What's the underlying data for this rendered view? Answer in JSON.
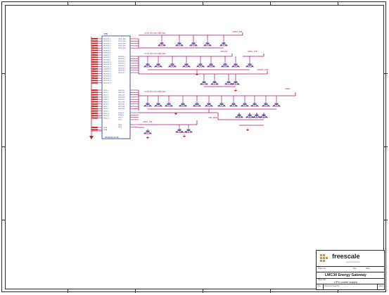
{
  "title_block": {
    "company": "freescale",
    "company_tagline": "semiconductor",
    "project": "LMC30 Energy Gateway",
    "sheet_title": "CPU power supply",
    "drawn_label": "Drawn by:",
    "page_label": "Page title:",
    "size_label": "Size",
    "doc_label": "Document Number",
    "rev_label": "Rev",
    "sheet_label": "Sheet",
    "date_label": "Date:",
    "drawn_value": "",
    "rev_value": ""
  },
  "ic": {
    "ref": "U5B",
    "part": "MCIMX28LCVL2B",
    "left_pins": [
      "VDDIO33_0",
      "VDDIO33_1",
      "VDDIO33_2",
      "VDDIO33_3",
      "VDDIO33_4",
      "VDDIO33_5",
      "VDDIO33_6",
      "VDDIO33_7",
      "VDDIO33_8",
      "VDDIO33_9",
      "VDDIO33_10",
      "VDDIO33_11",
      "VDDIO33_12",
      "VDDIO33_13",
      "VDDIO33_14",
      "VDDIO33_15",
      "VDDIO33_16",
      "VDDIO33_17",
      "VDDIO33_18",
      "VDDIO33_19"
    ],
    "left_pins_b": [
      "VDDD_0",
      "VDDD_1",
      "VDDD_2",
      "VDDD_3",
      "VDDD_4",
      "VDDD_5",
      "VDDD_6",
      "VDDD_7",
      "VDDD_8",
      "VDDD_9",
      "VDDD_10",
      "VDDD_11",
      "VDDD_12"
    ],
    "left_pins_c": [
      "VDDA",
      "VSSA"
    ],
    "right_pins": [
      "VDDIO_EMI",
      "VDDIO_EMI",
      "VDDIO_EMI",
      "VDDIO_EMI",
      "VDDIO_EMI"
    ],
    "right_pins_b": [
      "VDDIO18_0",
      "VDDIO18_1",
      "VDDIO18_2",
      "VDDIO18_3",
      "VDDIO18_4",
      "VDDIO18_5",
      "VDDIO18_6",
      "VDDIO18_7"
    ],
    "right_pins_c": [
      "VDDD_M1",
      "VDDD_M2",
      "VDDD_M3",
      "VDDD_M4",
      "VDDD_M5",
      "VDDD_M6",
      "VDDD_M7",
      "VDDD_M8",
      "VDDD_M9"
    ],
    "right_pins_d": [
      "VDDA_M",
      "VSSA_M",
      "VSS_1",
      "VSS_2"
    ],
    "right_pins_e": [
      "VREF",
      "VBUS"
    ]
  },
  "nets": {
    "bus1": "0.1UF 16V 10% X5R 0402",
    "bus1_label": "VDDIO_EMI",
    "bus2": "0.1UF 16V 10% X5R 0402",
    "bus2_label_a": "VDD1P8",
    "bus2_label_b": "VDDA_1P8",
    "bus2_label_c": "VDD4P2_REF",
    "bus3": "0.1UF 16V 10% X5R 0402",
    "bus3_label": "VDDD",
    "bus4_label": "VDD_MEM",
    "bus5_label": "VDDA_1P8"
  },
  "colors": {
    "wire": "#a8106e",
    "component": "#1c2d8c",
    "ground": "#d11a1a",
    "frame": "#2a2a2a"
  }
}
